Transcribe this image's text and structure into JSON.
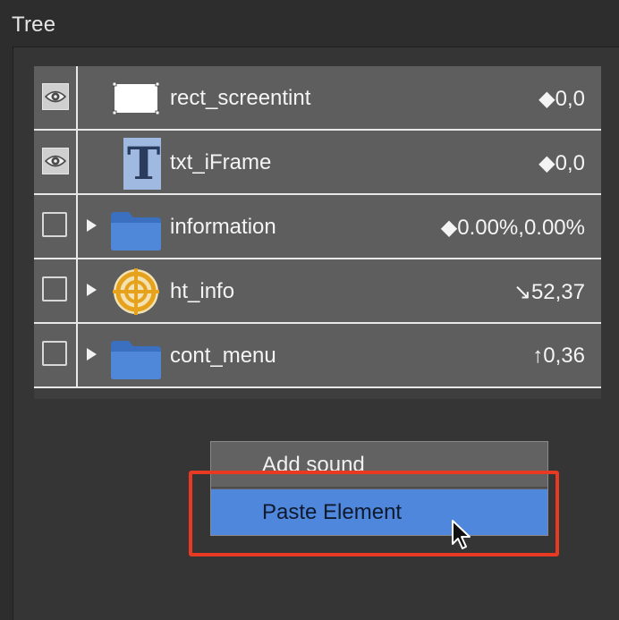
{
  "panel": {
    "title": "Tree"
  },
  "rows": [
    {
      "label": "rect_screentint",
      "value": "◆0,0",
      "visible": true,
      "icon": "rectangle-icon"
    },
    {
      "label": "txt_iFrame",
      "value": "◆0,0",
      "visible": true,
      "icon": "text-icon",
      "icon_glyph": "T"
    },
    {
      "label": "information",
      "value": "◆0.00%,0.00%",
      "visible": false,
      "icon": "folder-icon"
    },
    {
      "label": "ht_info",
      "value": "↘52,37",
      "visible": false,
      "icon": "hotspot-target-icon"
    },
    {
      "label": "cont_menu",
      "value": "↑0,36",
      "visible": false,
      "icon": "folder-icon"
    }
  ],
  "context_menu": {
    "items": [
      {
        "label": "Add sound"
      },
      {
        "label": "Paste Element",
        "active": true
      }
    ]
  },
  "colors": {
    "highlight_box": "#e83a22",
    "menu_active": "#4f87dc",
    "folder": "#4f88d8"
  }
}
